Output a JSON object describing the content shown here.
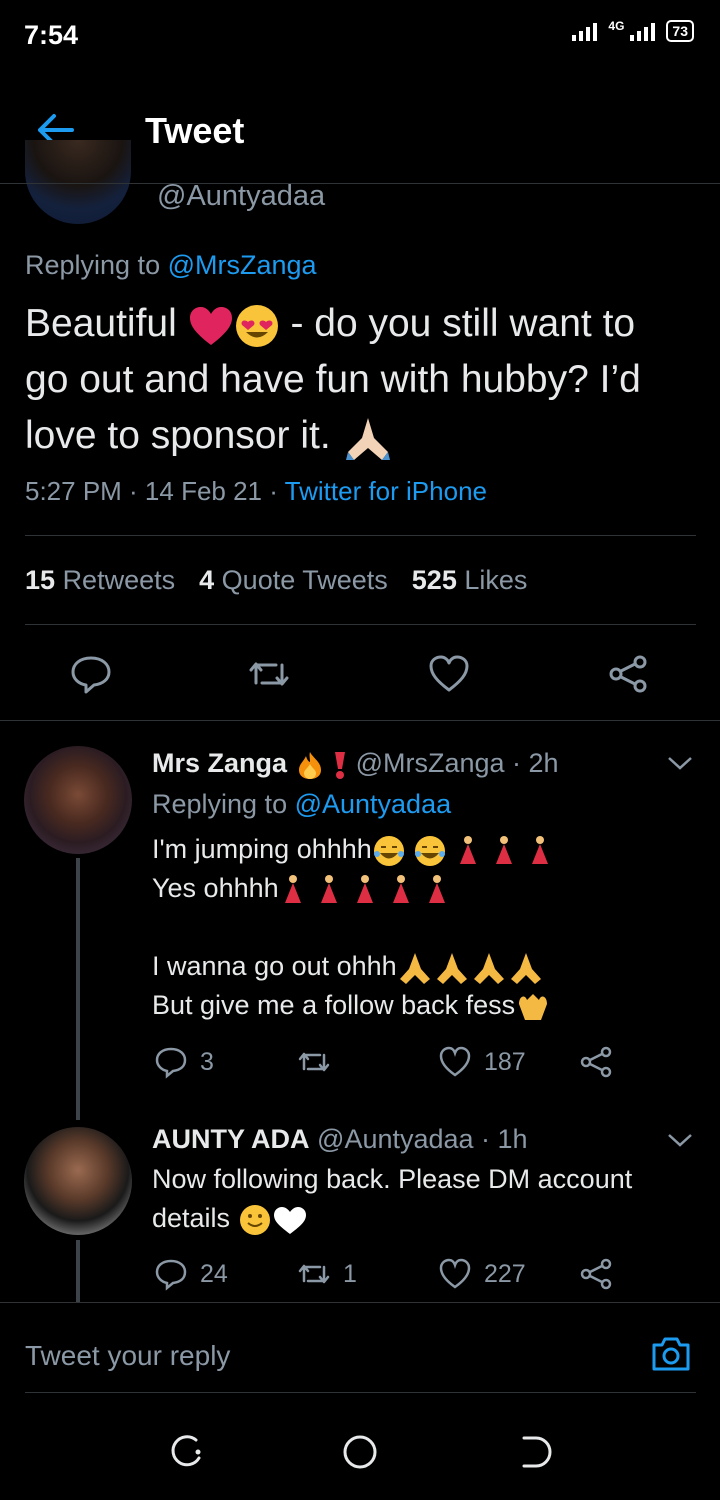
{
  "status_bar": {
    "time": "7:54",
    "network": "4G",
    "battery": "73"
  },
  "header": {
    "title": "Tweet"
  },
  "main_tweet": {
    "handle": "@Auntyadaa",
    "replying_prefix": "Replying to ",
    "replying_to": "@MrsZanga",
    "text_1": "Beautiful ",
    "text_2": " - do you still want to go out and have fun with hubby? I’d love to sponsor it. ",
    "time": "5:27 PM · 14 Feb 21 · ",
    "source": "Twitter for iPhone",
    "retweets_count": "15",
    "retweets_label": "Retweets",
    "quotes_count": "4",
    "quotes_label": "Quote Tweets",
    "likes_count": "525",
    "likes_label": "Likes"
  },
  "reply_1": {
    "name": "Mrs Zanga",
    "handle_time": "@MrsZanga · 2h",
    "replying_prefix": "Replying to ",
    "replying_to": "@Auntyadaa",
    "line_1": "I'm jumping ohhhh",
    "line_2": "Yes ohhhh",
    "line_3": "I wanna go out ohhh",
    "line_4": "But give me a follow back fess",
    "replies": "3",
    "retweets": "",
    "likes": "187"
  },
  "reply_2": {
    "name": "AUNTY ADA",
    "handle_time": "@Auntyadaa · 1h",
    "text": "Now following back. Please DM account details ",
    "replies": "24",
    "retweets": "1",
    "likes": "227"
  },
  "composer": {
    "placeholder": "Tweet your reply"
  },
  "icons": {
    "back": "arrow-left-icon",
    "reply": "comment-icon",
    "retweet": "retweet-icon",
    "like": "heart-icon",
    "share": "share-icon",
    "more": "chevron-down-icon",
    "camera": "camera-icon"
  },
  "colors": {
    "accent": "#1d9bf0",
    "background": "#000000",
    "muted": "#8b98a5"
  }
}
